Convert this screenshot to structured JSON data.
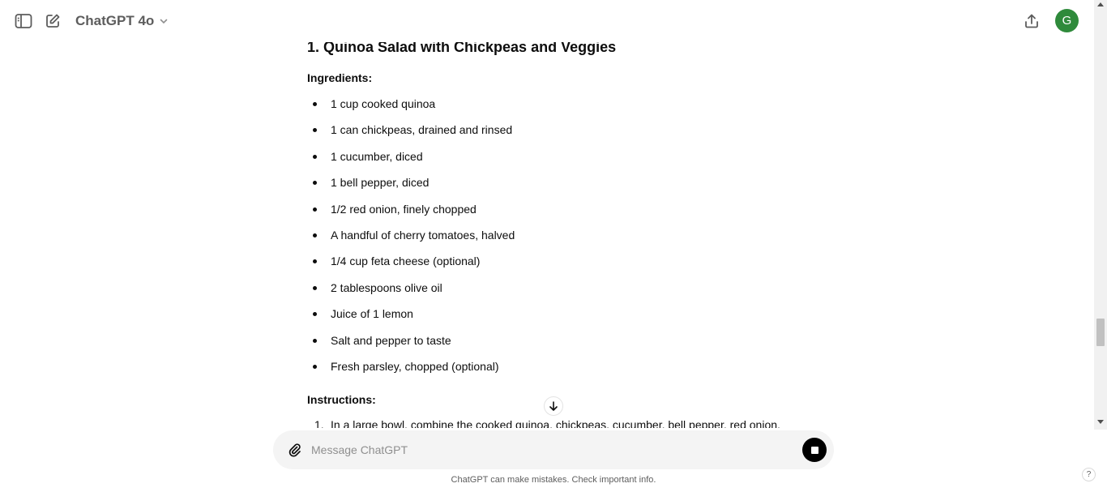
{
  "header": {
    "model_label": "ChatGPT 4o",
    "avatar_initial": "G",
    "sidebar_toggle_icon": "sidebar-toggle-icon",
    "new_chat_icon": "new-chat-icon",
    "share_icon": "share-icon"
  },
  "message": {
    "heading": "1. Quinoa Salad with Chickpeas and Veggies",
    "ingredients_label": "Ingredients:",
    "ingredients": [
      "1 cup cooked quinoa",
      "1 can chickpeas, drained and rinsed",
      "1 cucumber, diced",
      "1 bell pepper, diced",
      "1/2 red onion, finely chopped",
      "A handful of cherry tomatoes, halved",
      "1/4 cup feta cheese (optional)",
      "2 tablespoons olive oil",
      "Juice of 1 lemon",
      "Salt and pepper to taste",
      "Fresh parsley, chopped (optional)"
    ],
    "instructions_label": "Instructions:",
    "steps": [
      {
        "num": "1.",
        "text": "In a large bowl, combine the cooked quinoa, chickpeas, cucumber, bell pepper, red onion,"
      }
    ]
  },
  "composer": {
    "placeholder": "Message ChatGPT"
  },
  "footer": {
    "disclaimer": "ChatGPT can make mistakes. Check important info.",
    "help_label": "?"
  },
  "colors": {
    "avatar": "#2f8a3b",
    "composer_bg": "#f4f4f4",
    "stop_button": "#000000"
  }
}
